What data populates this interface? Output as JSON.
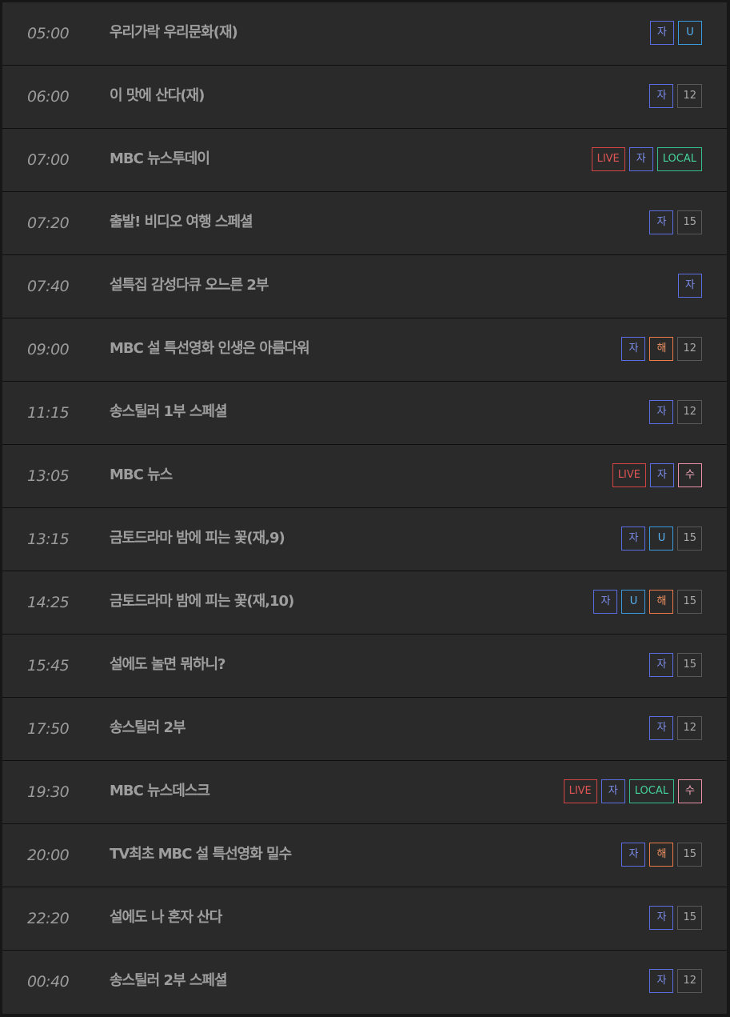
{
  "schedule": [
    {
      "time": "05:00",
      "title": "우리가락 우리문화(재)",
      "badges": [
        {
          "label": "자",
          "kind": "ja"
        },
        {
          "label": "U",
          "kind": "u"
        }
      ]
    },
    {
      "time": "06:00",
      "title": "이 맛에 산다(재)",
      "badges": [
        {
          "label": "자",
          "kind": "ja"
        },
        {
          "label": "12",
          "kind": "age"
        }
      ]
    },
    {
      "time": "07:00",
      "title": "MBC 뉴스투데이",
      "badges": [
        {
          "label": "LIVE",
          "kind": "live"
        },
        {
          "label": "자",
          "kind": "ja"
        },
        {
          "label": "LOCAL",
          "kind": "local"
        }
      ]
    },
    {
      "time": "07:20",
      "title": "출발! 비디오 여행 스페셜",
      "badges": [
        {
          "label": "자",
          "kind": "ja"
        },
        {
          "label": "15",
          "kind": "age"
        }
      ]
    },
    {
      "time": "07:40",
      "title": "설특집 감성다큐 오느른 2부",
      "badges": [
        {
          "label": "자",
          "kind": "ja"
        }
      ]
    },
    {
      "time": "09:00",
      "title": "MBC 설 특선영화 인생은 아름다워",
      "badges": [
        {
          "label": "자",
          "kind": "ja"
        },
        {
          "label": "해",
          "kind": "hae"
        },
        {
          "label": "12",
          "kind": "age"
        }
      ]
    },
    {
      "time": "11:15",
      "title": "송스틸러 1부 스페셜",
      "badges": [
        {
          "label": "자",
          "kind": "ja"
        },
        {
          "label": "12",
          "kind": "age"
        }
      ]
    },
    {
      "time": "13:05",
      "title": "MBC 뉴스",
      "badges": [
        {
          "label": "LIVE",
          "kind": "live"
        },
        {
          "label": "자",
          "kind": "ja"
        },
        {
          "label": "수",
          "kind": "su"
        }
      ]
    },
    {
      "time": "13:15",
      "title": "금토드라마 밤에 피는 꽃(재,9)",
      "badges": [
        {
          "label": "자",
          "kind": "ja"
        },
        {
          "label": "U",
          "kind": "u"
        },
        {
          "label": "15",
          "kind": "age"
        }
      ]
    },
    {
      "time": "14:25",
      "title": "금토드라마 밤에 피는 꽃(재,10)",
      "badges": [
        {
          "label": "자",
          "kind": "ja"
        },
        {
          "label": "U",
          "kind": "u"
        },
        {
          "label": "해",
          "kind": "hae"
        },
        {
          "label": "15",
          "kind": "age"
        }
      ]
    },
    {
      "time": "15:45",
      "title": "설에도 놀면 뭐하니?",
      "badges": [
        {
          "label": "자",
          "kind": "ja"
        },
        {
          "label": "15",
          "kind": "age"
        }
      ]
    },
    {
      "time": "17:50",
      "title": "송스틸러 2부",
      "badges": [
        {
          "label": "자",
          "kind": "ja"
        },
        {
          "label": "12",
          "kind": "age"
        }
      ]
    },
    {
      "time": "19:30",
      "title": "MBC 뉴스데스크",
      "badges": [
        {
          "label": "LIVE",
          "kind": "live"
        },
        {
          "label": "자",
          "kind": "ja"
        },
        {
          "label": "LOCAL",
          "kind": "local"
        },
        {
          "label": "수",
          "kind": "su"
        }
      ]
    },
    {
      "time": "20:00",
      "title": "TV최초 MBC 설 특선영화 밀수",
      "badges": [
        {
          "label": "자",
          "kind": "ja"
        },
        {
          "label": "해",
          "kind": "hae"
        },
        {
          "label": "15",
          "kind": "age"
        }
      ]
    },
    {
      "time": "22:20",
      "title": "설에도 나 혼자 산다",
      "badges": [
        {
          "label": "자",
          "kind": "ja"
        },
        {
          "label": "15",
          "kind": "age"
        }
      ]
    },
    {
      "time": "00:40",
      "title": "송스틸러 2부 스페셜",
      "badges": [
        {
          "label": "자",
          "kind": "ja"
        },
        {
          "label": "12",
          "kind": "age"
        }
      ]
    }
  ],
  "colors": {
    "live": "#d44444",
    "ja": "#5b6ee3",
    "u": "#3a9be0",
    "local": "#34c08c",
    "hae": "#ee7a4a",
    "su": "#ec8fa8",
    "age": "#585858",
    "background": "#2a2a2a"
  }
}
